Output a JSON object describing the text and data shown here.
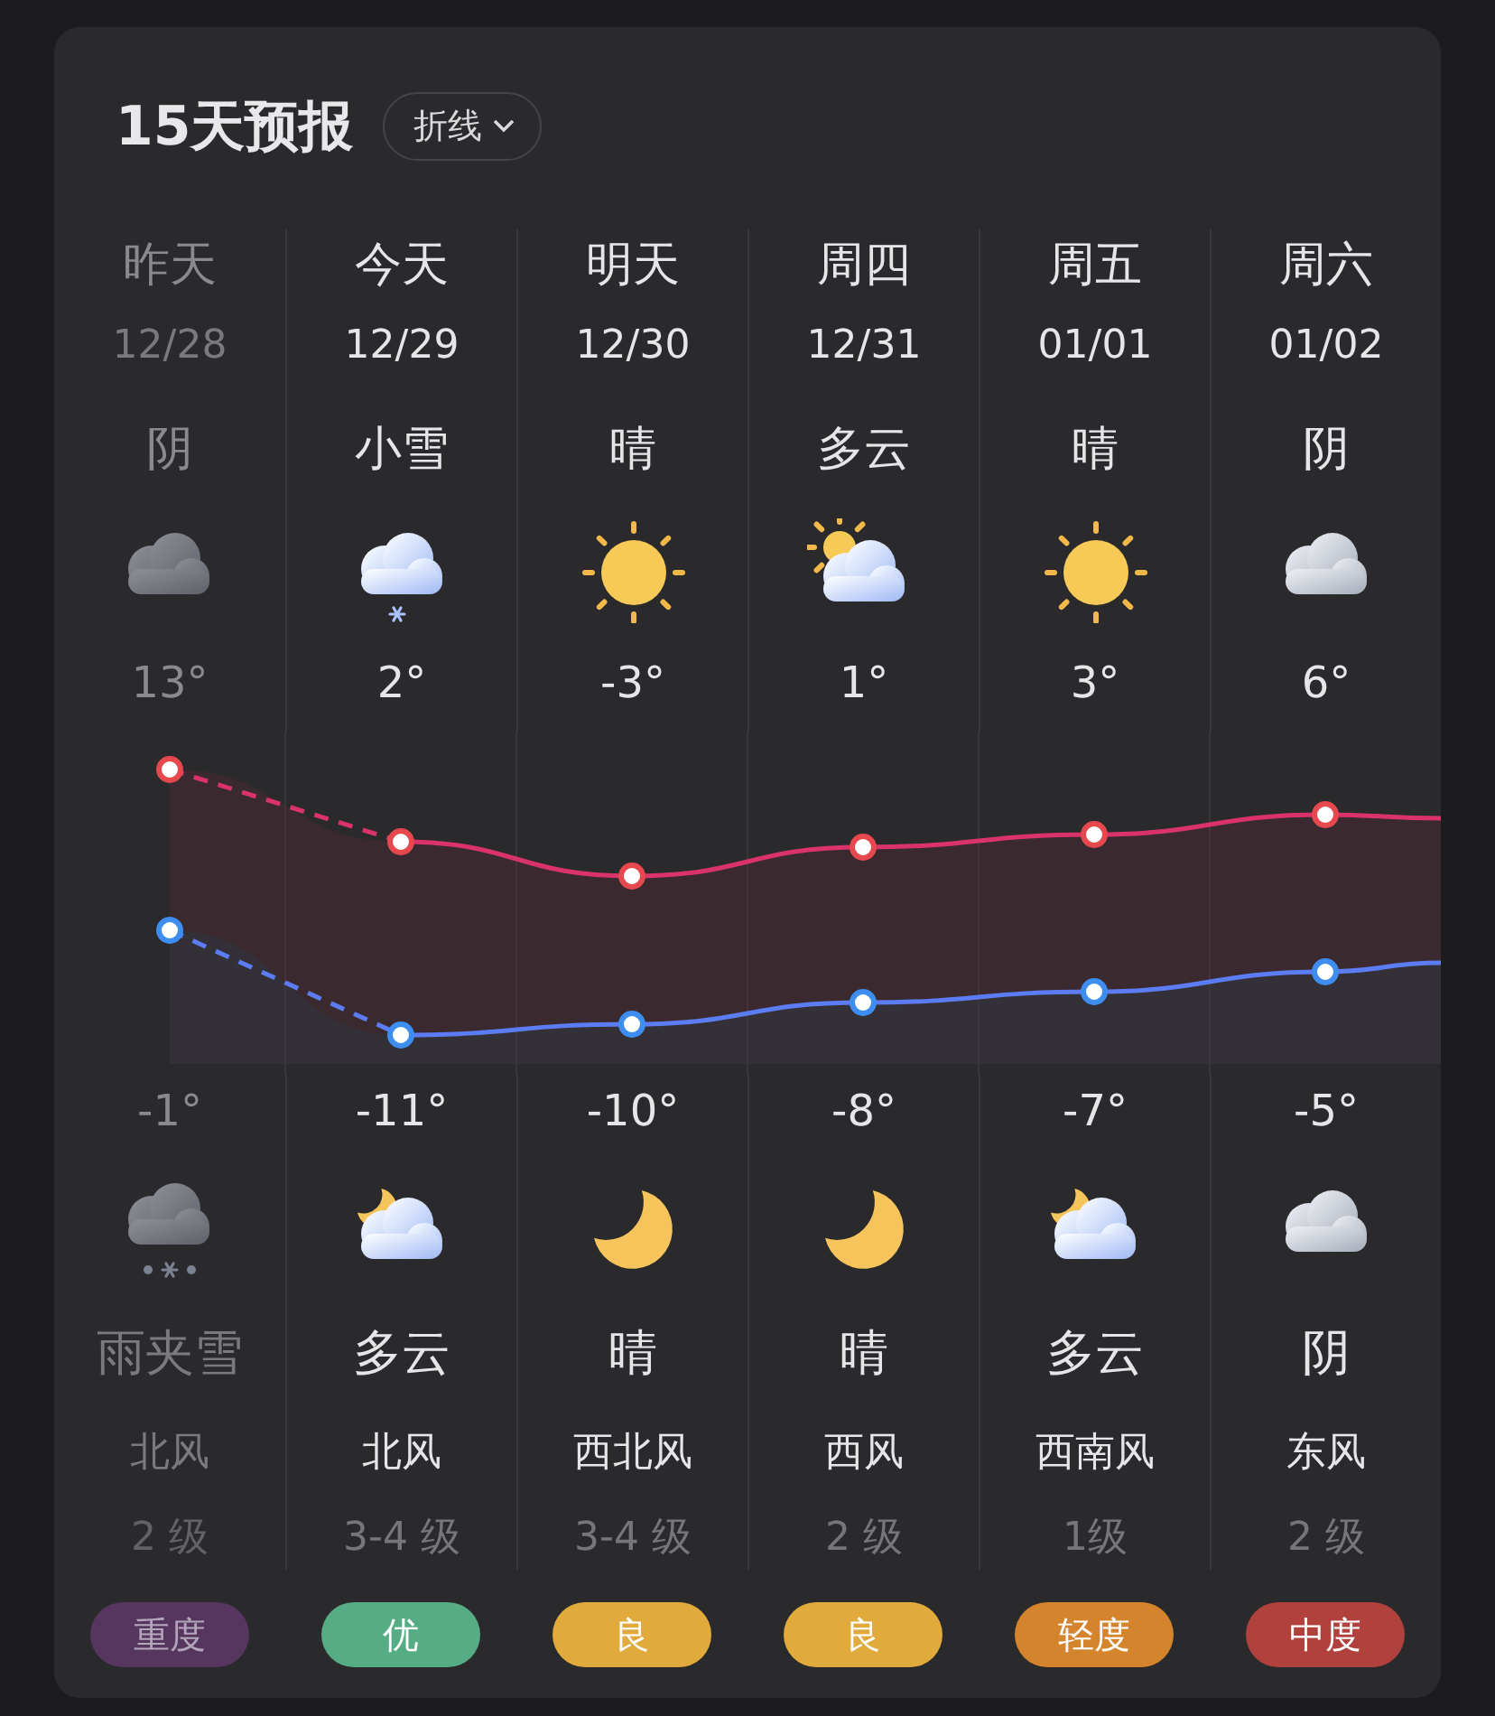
{
  "title": "15天预报",
  "view_menu": {
    "label": "折线"
  },
  "days": [
    {
      "name": "昨天",
      "date": "12/28",
      "past": true,
      "day_weather": "阴",
      "day_icon": {
        "kind": "cloudy"
      },
      "high": "13°",
      "low": "-1°",
      "night_icon": {
        "kind": "rain-snow"
      },
      "night_weather": "雨夹雪",
      "wind": "北风",
      "wind_level": "2 级",
      "aqi": "重度",
      "color": "#56365f"
    },
    {
      "name": "今天",
      "date": "12/29",
      "past": false,
      "day_weather": "小雪",
      "day_icon": {
        "kind": "snow"
      },
      "high": "2°",
      "low": "-11°",
      "night_icon": {
        "kind": "cloud-moon"
      },
      "night_weather": "多云",
      "wind": "北风",
      "wind_level": "3-4 级",
      "aqi": "优",
      "color": "#56ad85"
    },
    {
      "name": "明天",
      "date": "12/30",
      "past": false,
      "day_weather": "晴",
      "day_icon": {
        "kind": "sun"
      },
      "high": "-3°",
      "low": "-10°",
      "night_icon": {
        "kind": "moon"
      },
      "night_weather": "晴",
      "wind": "西北风",
      "wind_level": "3-4 级",
      "aqi": "良",
      "color": "#e0aa3c"
    },
    {
      "name": "周四",
      "date": "12/31",
      "past": false,
      "day_weather": "多云",
      "day_icon": {
        "kind": "cloud-sun"
      },
      "high": "1°",
      "low": "-8°",
      "night_icon": {
        "kind": "moon"
      },
      "night_weather": "晴",
      "wind": "西风",
      "wind_level": "2 级",
      "aqi": "良",
      "color": "#e0aa3c"
    },
    {
      "name": "周五",
      "date": "01/01",
      "past": false,
      "day_weather": "晴",
      "day_icon": {
        "kind": "sun"
      },
      "high": "3°",
      "low": "-7°",
      "night_icon": {
        "kind": "cloud-moon"
      },
      "night_weather": "多云",
      "wind": "西南风",
      "wind_level": "1级",
      "aqi": "轻度",
      "color": "#d4842c"
    },
    {
      "name": "周六",
      "date": "01/02",
      "past": false,
      "day_weather": "阴",
      "day_icon": {
        "kind": "cloudy-light"
      },
      "high": "6°",
      "low": "-5°",
      "night_icon": {
        "kind": "cloudy-light"
      },
      "night_weather": "阴",
      "wind": "东风",
      "wind_level": "2 级",
      "aqi": "中度",
      "color": "#b0413c"
    }
  ]
}
